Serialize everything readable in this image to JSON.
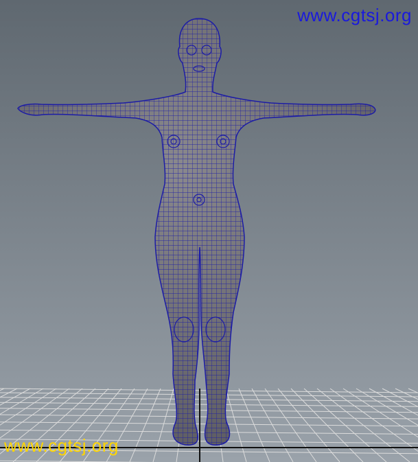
{
  "viewport": {
    "watermark_top": "www.cgtsj.org",
    "watermark_bottom": "www.cgtsj.org",
    "watermark_top_color": "#1a1adc",
    "watermark_bottom_color": "#ffd600",
    "mesh_fill_color": "#6f6e72",
    "wireframe_color": "#1c1ca6",
    "grid_color": "#dcdcdc",
    "grid_axis_color": "#111111",
    "gradient_top_color": "#5f6870",
    "gradient_bottom_color": "#9aa2aa"
  }
}
